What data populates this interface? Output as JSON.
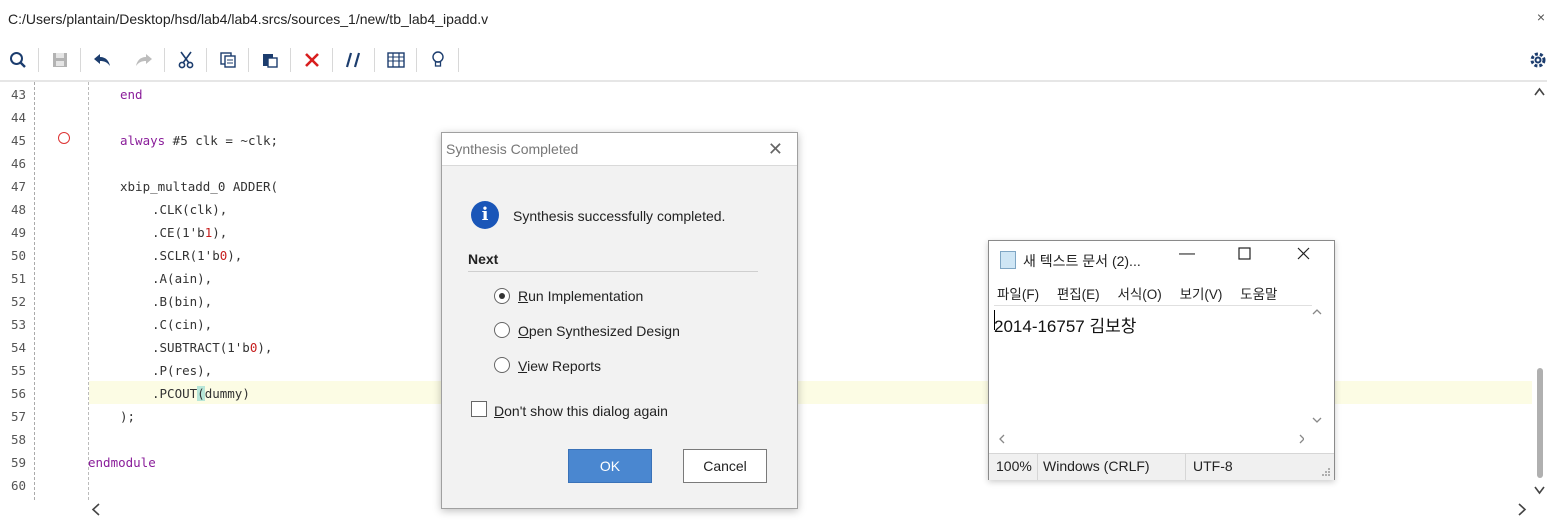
{
  "window": {
    "path": "C:/Users/plantain/Desktop/hsd/lab4/lab4.srcs/sources_1/new/tb_lab4_ipadd.v",
    "close_glyph": "×"
  },
  "toolbar": {
    "icons": [
      "search-icon",
      "save-icon",
      "undo-icon",
      "redo-icon",
      "cut-icon",
      "copy-icon",
      "paste-icon",
      "delete-icon",
      "comment-icon",
      "columns-icon",
      "lightbulb-icon",
      "settings-icon"
    ]
  },
  "editor": {
    "line_numbers": [
      "43",
      "44",
      "45",
      "46",
      "47",
      "48",
      "49",
      "50",
      "51",
      "52",
      "53",
      "54",
      "55",
      "56",
      "57",
      "58",
      "59",
      "60"
    ],
    "lines": {
      "l43": "end",
      "l45_kw": "always",
      "l45_rest": " #5 clk = ~clk;",
      "l47": "xbip_multadd_0 ADDER(",
      "l48": ".CLK(clk),",
      "l49_a": ".CE(1'b",
      "l49_n": "1",
      "l49_b": "),",
      "l50_a": ".SCLR(1'b",
      "l50_n": "0",
      "l50_b": "),",
      "l51": ".A(ain),",
      "l52": ".B(bin),",
      "l53": ".C(cin),",
      "l54_a": ".SUBTRACT(1'b",
      "l54_n": "0",
      "l54_b": "),",
      "l55": ".P(res),",
      "l56_a": ".PCOUT",
      "l56_p1": "(",
      "l56_b": "dummy)",
      "l57": ");",
      "l59": "endmodule"
    }
  },
  "dialog": {
    "title": "Synthesis Completed",
    "message": "Synthesis successfully completed.",
    "next_label": "Next",
    "options": [
      {
        "key": "R",
        "rest": "un Implementation",
        "selected": true
      },
      {
        "key": "O",
        "rest": "pen Synthesized Design",
        "selected": false
      },
      {
        "key": "V",
        "rest": "iew Reports",
        "selected": false
      }
    ],
    "checkbox_key": "D",
    "checkbox_rest": "on't show this dialog again",
    "ok_label": "OK",
    "cancel_label": "Cancel"
  },
  "notepad": {
    "title": "새 텍스트 문서 (2)...",
    "menu": [
      "파일(F)",
      "편집(E)",
      "서식(O)",
      "보기(V)",
      "도움말"
    ],
    "content": "2014-16757 김보창",
    "status": {
      "zoom": "100%",
      "line_ending": "Windows (CRLF)",
      "encoding": "UTF-8"
    }
  },
  "colors": {
    "keyword": "#8a1d9a",
    "number": "#c61d1d",
    "ok_button": "#4a87d0",
    "info_icon": "#1a56b8"
  }
}
